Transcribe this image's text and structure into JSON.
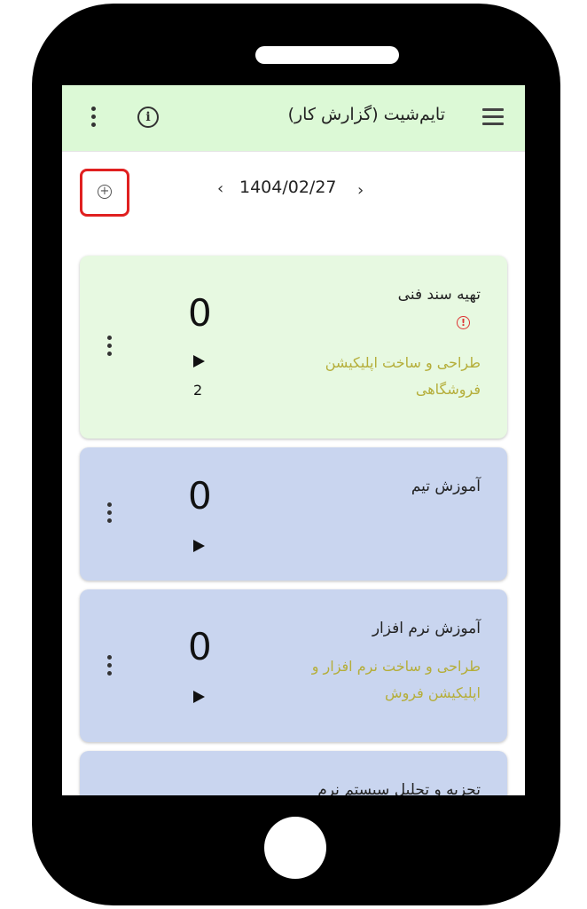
{
  "appbar": {
    "title": "تایم‌شیت (گزارش کار)",
    "menu_icon": "hamburger-menu-icon",
    "info_icon": "info-icon",
    "more_icon": "more-vert-icon"
  },
  "date_nav": {
    "date": "1404/02/27",
    "prev_icon": "chevron-left-icon",
    "next_icon": "chevron-right-icon"
  },
  "add_button": {
    "icon": "add-circle-icon",
    "highlight_color": "#e02020"
  },
  "colors": {
    "appbar_bg": "#dcf9d6",
    "card_active_bg": "#e7f9e1",
    "card_bg": "#c9d5ef",
    "project_text": "#b5ae3a",
    "warning": "#dd3333"
  },
  "cards": [
    {
      "title": "تهیه سند فنی",
      "project": "طراحی و ساخت اپلیکیشن فروشگاهی",
      "count": "0",
      "play_count": "2",
      "warning": true
    },
    {
      "title": "آموزش تیم",
      "project": "",
      "count": "0",
      "play_count": "",
      "warning": false
    },
    {
      "title": "آموزش نرم افزار",
      "project": "طراحی و ساخت نرم افزار و اپلیکیشن فروش",
      "count": "0",
      "play_count": "",
      "warning": false
    },
    {
      "title": "تجزیه و تحلیل سیستم نرم",
      "project": "",
      "count": "",
      "play_count": "",
      "warning": false
    }
  ]
}
